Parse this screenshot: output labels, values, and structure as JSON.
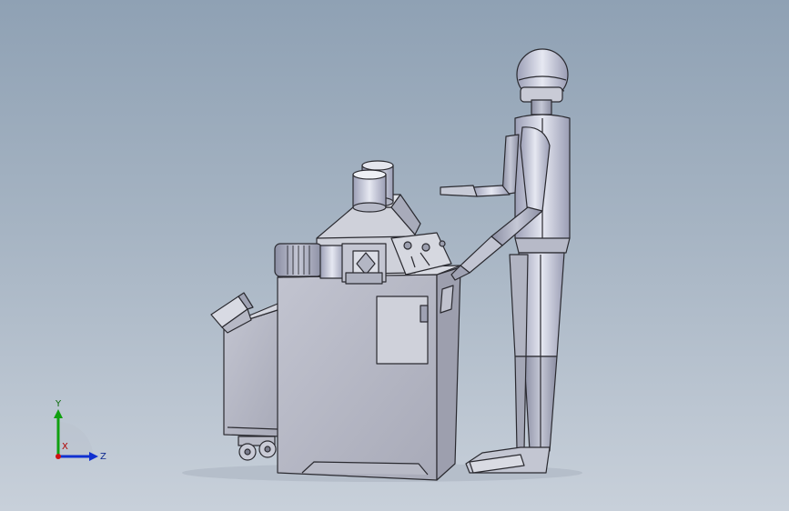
{
  "viewport": {
    "background_top": "#8fa1b4",
    "background_bottom": "#c8d0da"
  },
  "model": {
    "machine": "machine-assembly",
    "figure": "human-figure"
  },
  "triad": {
    "x_label": "X",
    "y_label": "Y",
    "z_label": "Z",
    "x_color": "#d01010",
    "y_color": "#10a010",
    "z_color": "#1030d0"
  }
}
